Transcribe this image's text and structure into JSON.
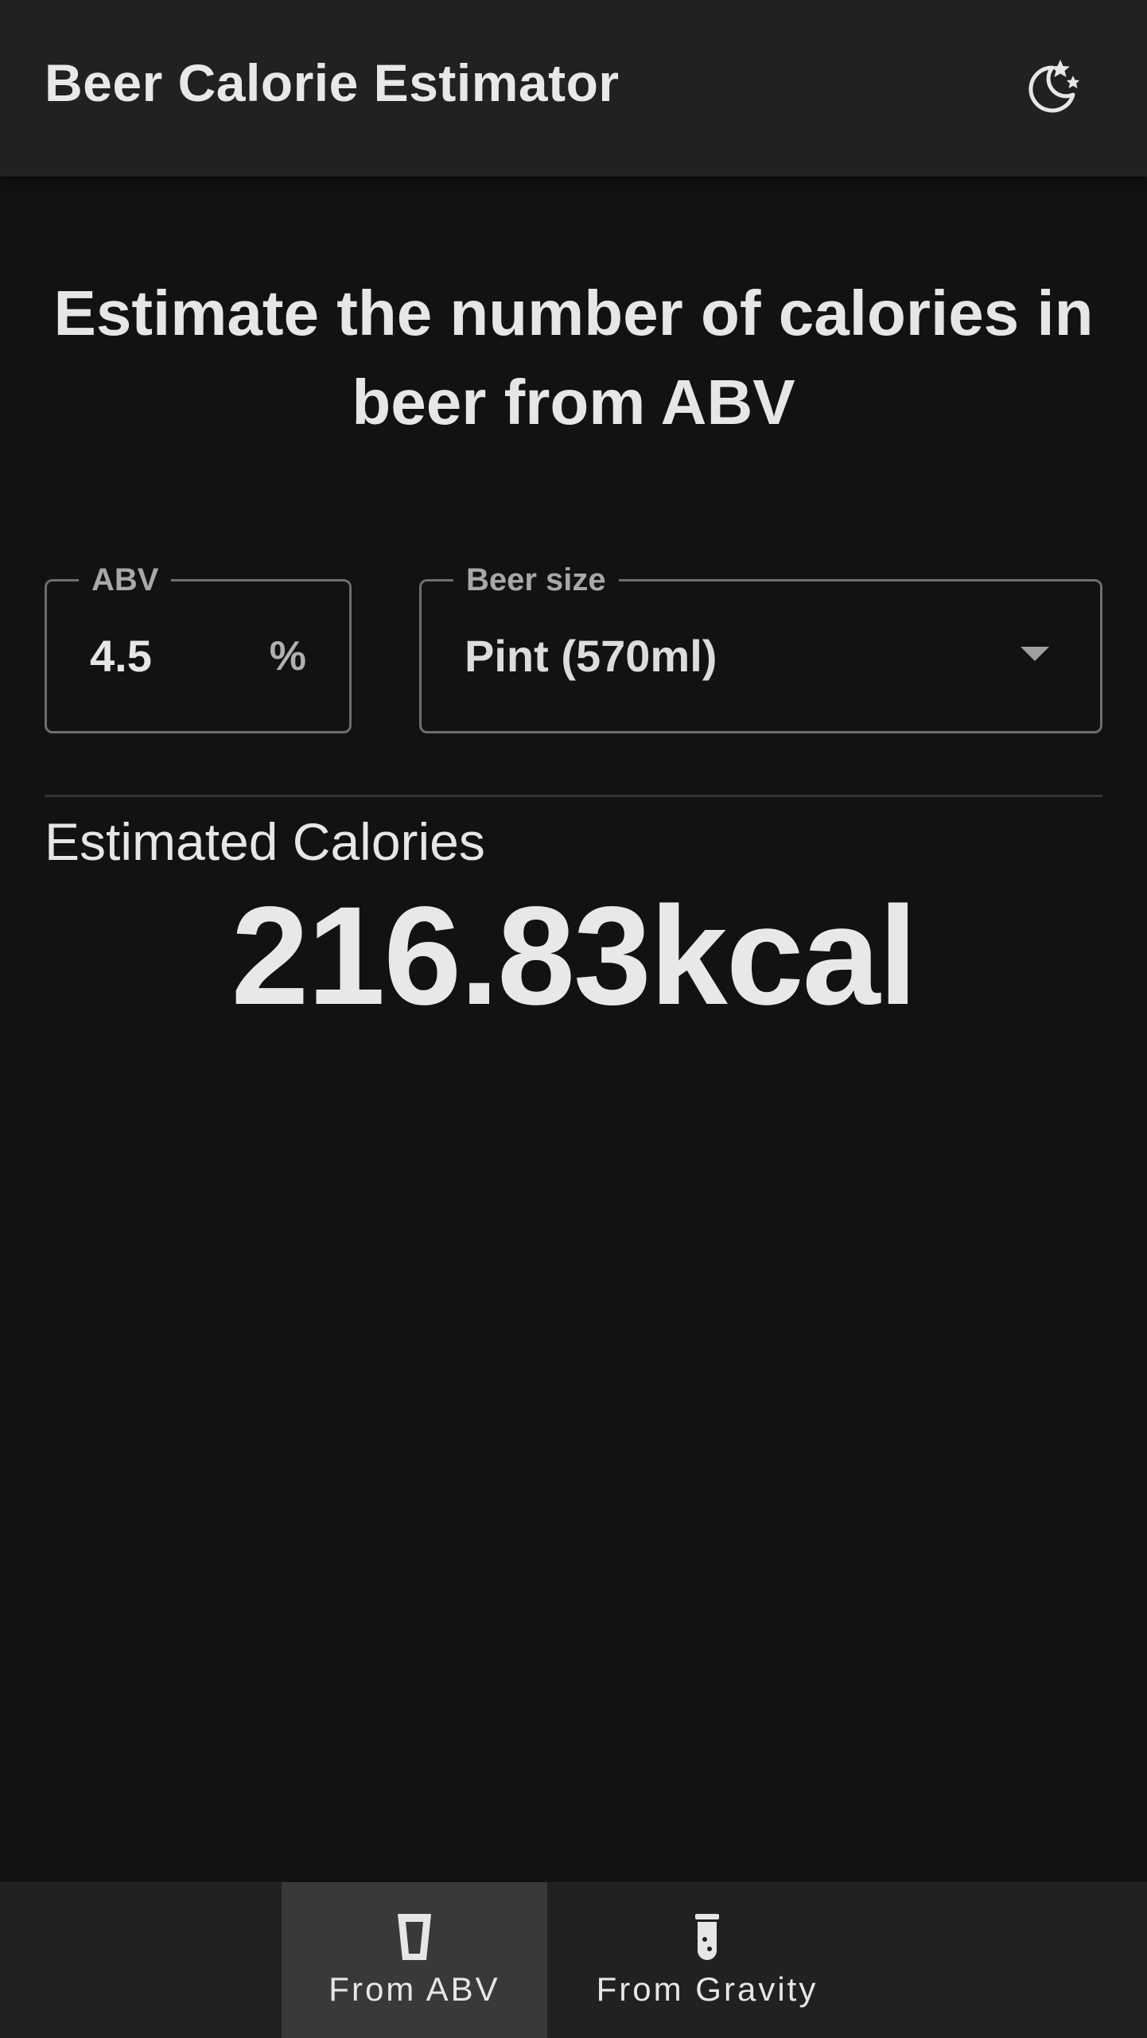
{
  "app_bar": {
    "title": "Beer Calorie Estimator",
    "theme_toggle_icon": "moon-stars-icon"
  },
  "headline": "Estimate the number of calories in beer from ABV",
  "abv_field": {
    "label": "ABV",
    "value": "4.5",
    "unit": "%"
  },
  "size_field": {
    "label": "Beer size",
    "selected": "Pint (570ml)",
    "icon": "chevron-down-icon"
  },
  "result": {
    "label": "Estimated Calories",
    "value": "216.83kcal"
  },
  "bottom_nav": {
    "items": [
      {
        "label": "From ABV",
        "icon": "beer-glass-icon",
        "active": true
      },
      {
        "label": "From Gravity",
        "icon": "test-tube-icon",
        "active": false
      }
    ]
  },
  "colors": {
    "background": "#121212",
    "app_bar": "#212121",
    "nav_active": "#393939",
    "text": "#e6e6e6",
    "outline": "#6e6e6e"
  }
}
